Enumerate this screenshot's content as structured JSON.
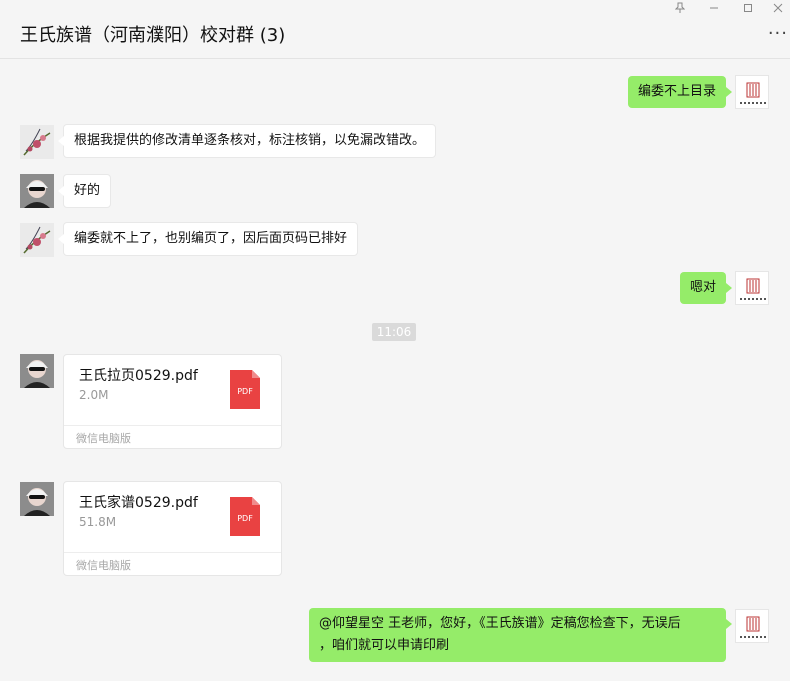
{
  "window": {
    "title": "王氏族谱（河南濮阳）校对群 (3)",
    "controls": {
      "pin": "pin-icon",
      "minimize": "minimize-icon",
      "maximize": "maximize-icon",
      "close": "close-icon"
    },
    "more": "···"
  },
  "messages": [
    {
      "side": "right",
      "text": "编委不上目录"
    },
    {
      "side": "left",
      "text": "根据我提供的修改清单逐条核对，标注核销，以免漏改错改。"
    },
    {
      "side": "left",
      "text": "好的"
    },
    {
      "side": "left",
      "text": "编委就不上了，也别编页了，因后面页码已排好"
    },
    {
      "side": "right",
      "text": "嗯对"
    }
  ],
  "timestamp": "11:06",
  "files": [
    {
      "name": "王氏拉页0529.pdf",
      "size": "2.0M",
      "type": "PDF",
      "source": "微信电脑版"
    },
    {
      "name": "王氏家谱0529.pdf",
      "size": "51.8M",
      "type": "PDF",
      "source": "微信电脑版"
    }
  ],
  "final_message": {
    "line1": "@仰望星空 王老师，您好，《王氏族谱》定稿您检查下，无误后",
    "line2": "，咱们就可以申请印刷"
  },
  "colors": {
    "bubble_right": "#95ec69",
    "bubble_left": "#ffffff",
    "pdf_red": "#e94242"
  }
}
